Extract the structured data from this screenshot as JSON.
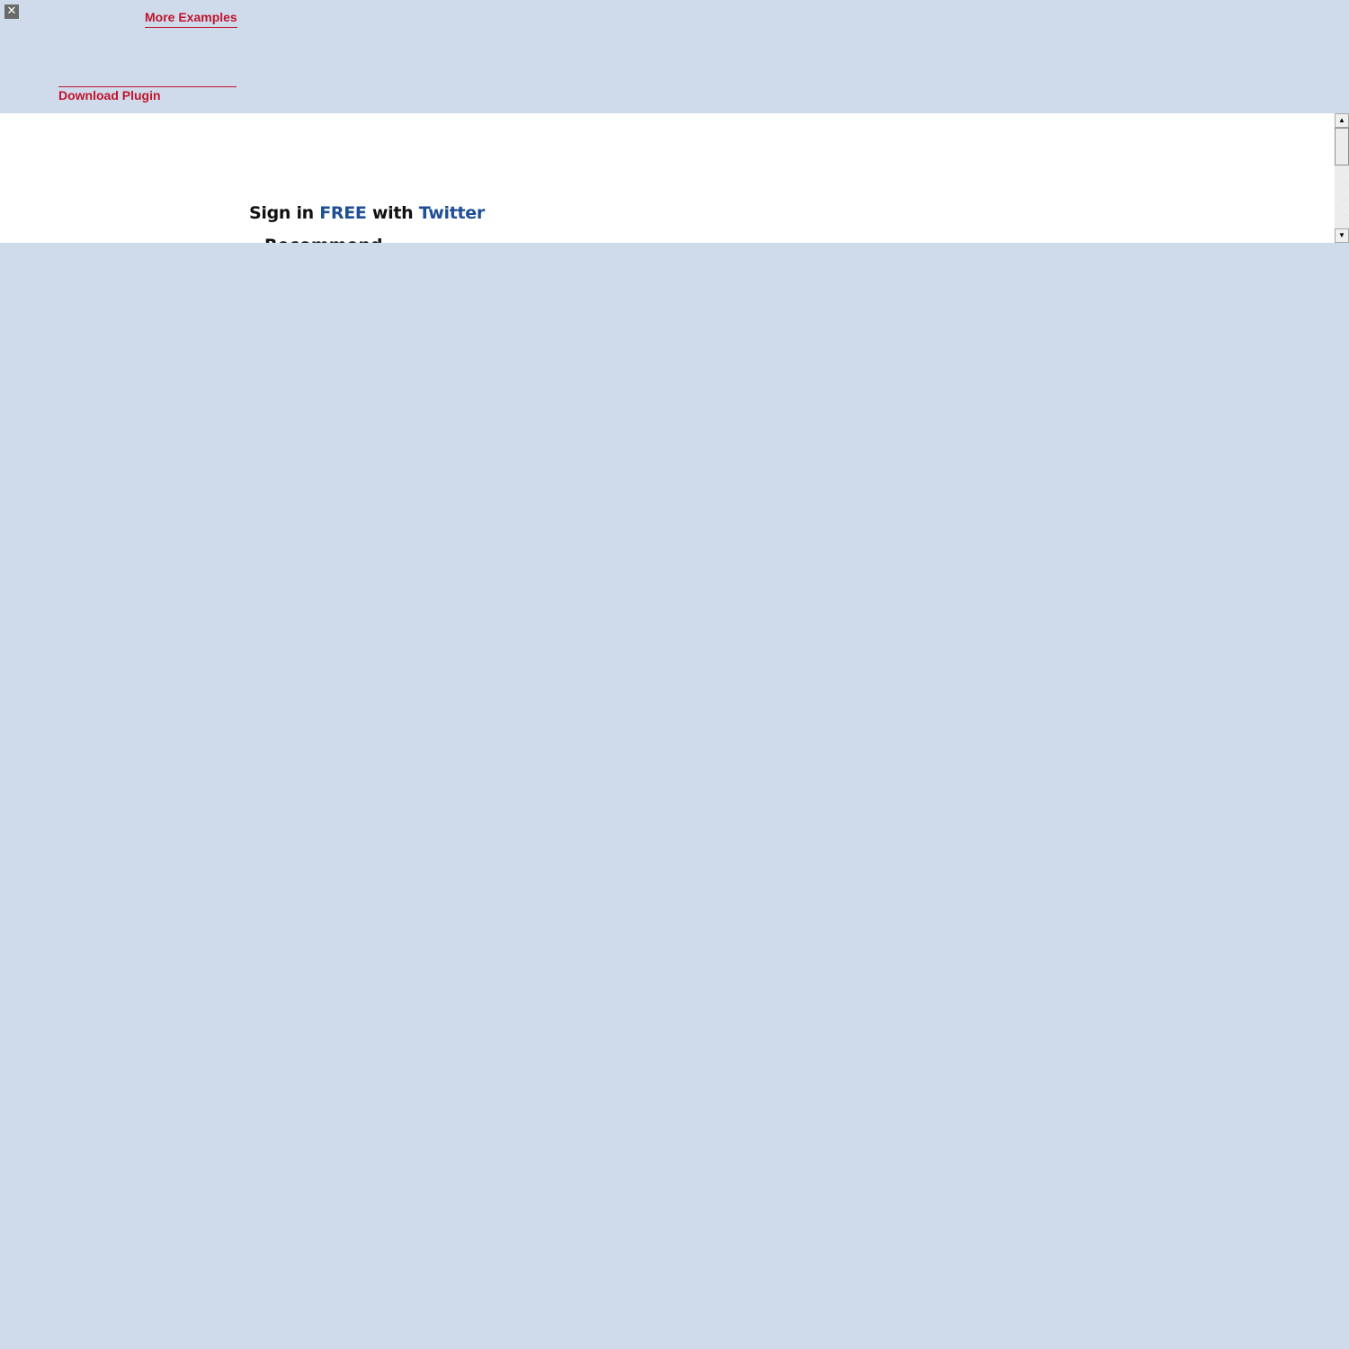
{
  "toolbar": {
    "close_glyph": "✕",
    "more_examples_label": "More Examples",
    "download_plugin_label": "Download Plugin"
  },
  "content": {
    "signin": {
      "prefix": "Sign in ",
      "free": "FREE",
      "middle": " with ",
      "service": "Twitter"
    },
    "next_line_partial": "Recommend..."
  },
  "scrollbar": {
    "up_glyph": "▲",
    "down_glyph": "▼"
  },
  "colors": {
    "background": "#cfdaeb",
    "link_red": "#c0142c",
    "accent_blue": "#1f4f94"
  }
}
